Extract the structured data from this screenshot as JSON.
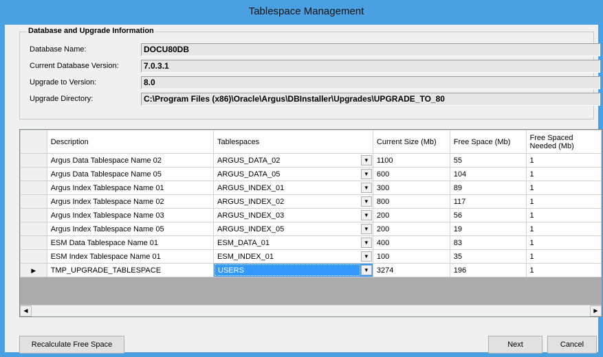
{
  "window": {
    "title": "Tablespace Management"
  },
  "info": {
    "group_title": "Database and Upgrade Information",
    "fields": [
      {
        "label": "Database Name:",
        "value": "DOCU80DB"
      },
      {
        "label": "Current Database Version:",
        "value": "7.0.3.1"
      },
      {
        "label": "Upgrade to Version:",
        "value": "8.0"
      },
      {
        "label": "Upgrade Directory:",
        "value": "C:\\Program Files (x86)\\Oracle\\Argus\\DBInstaller\\Upgrades\\UPGRADE_TO_80"
      }
    ]
  },
  "grid": {
    "columns": [
      "Description",
      "Tablespaces",
      "Current Size (Mb)",
      "Free Space (Mb)",
      "Free Spaced Needed (Mb)"
    ],
    "current_row_marker": "▶",
    "rows": [
      {
        "description": "Argus Data Tablespace Name 02",
        "tablespace": "ARGUS_DATA_02",
        "current_size": "1100",
        "free_space": "55",
        "needed": "1"
      },
      {
        "description": "Argus Data Tablespace Name 05",
        "tablespace": "ARGUS_DATA_05",
        "current_size": "600",
        "free_space": "104",
        "needed": "1"
      },
      {
        "description": "Argus Index Tablespace Name 01",
        "tablespace": "ARGUS_INDEX_01",
        "current_size": "300",
        "free_space": "89",
        "needed": "1"
      },
      {
        "description": "Argus Index Tablespace Name 02",
        "tablespace": "ARGUS_INDEX_02",
        "current_size": "800",
        "free_space": "117",
        "needed": "1"
      },
      {
        "description": "Argus Index Tablespace Name 03",
        "tablespace": "ARGUS_INDEX_03",
        "current_size": "200",
        "free_space": "56",
        "needed": "1"
      },
      {
        "description": "Argus Index Tablespace Name 05",
        "tablespace": "ARGUS_INDEX_05",
        "current_size": "200",
        "free_space": "19",
        "needed": "1"
      },
      {
        "description": "ESM Data Tablespace Name 01",
        "tablespace": "ESM_DATA_01",
        "current_size": "400",
        "free_space": "83",
        "needed": "1"
      },
      {
        "description": "ESM Index Tablespace Name 01",
        "tablespace": "ESM_INDEX_01",
        "current_size": "100",
        "free_space": "35",
        "needed": "1"
      },
      {
        "description": "TMP_UPGRADE_TABLESPACE",
        "tablespace": "USERS",
        "current_size": "3274",
        "free_space": "196",
        "needed": "1"
      }
    ]
  },
  "buttons": {
    "recalc_label": "Recalculate Free Space",
    "next_label": "Next",
    "cancel_label": "Cancel"
  },
  "icons": {
    "dropdown": "chevron-down-icon",
    "scroll_left": "arrow-left-icon",
    "scroll_right": "arrow-right-icon",
    "row_pointer": "row-pointer-icon"
  },
  "colors": {
    "title_bar": "#4aa0e0",
    "selection": "#3399ff",
    "grid_empty": "#ababab"
  }
}
